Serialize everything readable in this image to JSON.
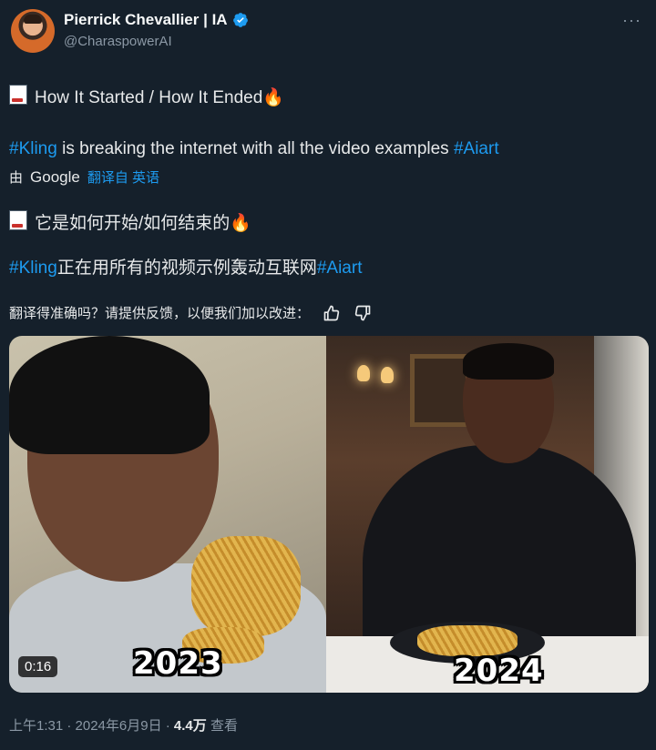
{
  "author": {
    "display_name": "Pierrick Chevallier | IA",
    "handle": "@CharaspowerAI",
    "verified_icon": "verified-badge-icon",
    "accent_color": "#1d9bf0"
  },
  "tweet": {
    "line1_text": "How It Started / How It Ended",
    "line1_emoji": "🔥",
    "line2_hashtag_start": "#Kling",
    "line2_middle": " is breaking the internet with all the video examples ",
    "line2_hashtag_end": "#Aiart"
  },
  "translation": {
    "by_prefix": "由",
    "provider": "Google",
    "translated_from": "翻译自 英语",
    "line1_text": "它是如何开始/如何结束的",
    "line1_emoji": "🔥",
    "line2_hashtag_start": "#Kling",
    "line2_middle": "正在用所有的视频示例轰动互联网",
    "line2_hashtag_end": "#Aiart",
    "feedback_prompt": "翻译得准确吗？请提供反馈，以便我们加以改进："
  },
  "media": {
    "duration": "0:16",
    "left_label": "2023",
    "right_label": "2024"
  },
  "meta": {
    "time_date": "上午1:31 · 2024年6月9日 · ",
    "views_count": "4.4万",
    "views_label": "查看"
  },
  "icons": [
    "more-options-icon",
    "thumbs-up-icon",
    "thumbs-down-icon",
    "broken-image-icon"
  ]
}
